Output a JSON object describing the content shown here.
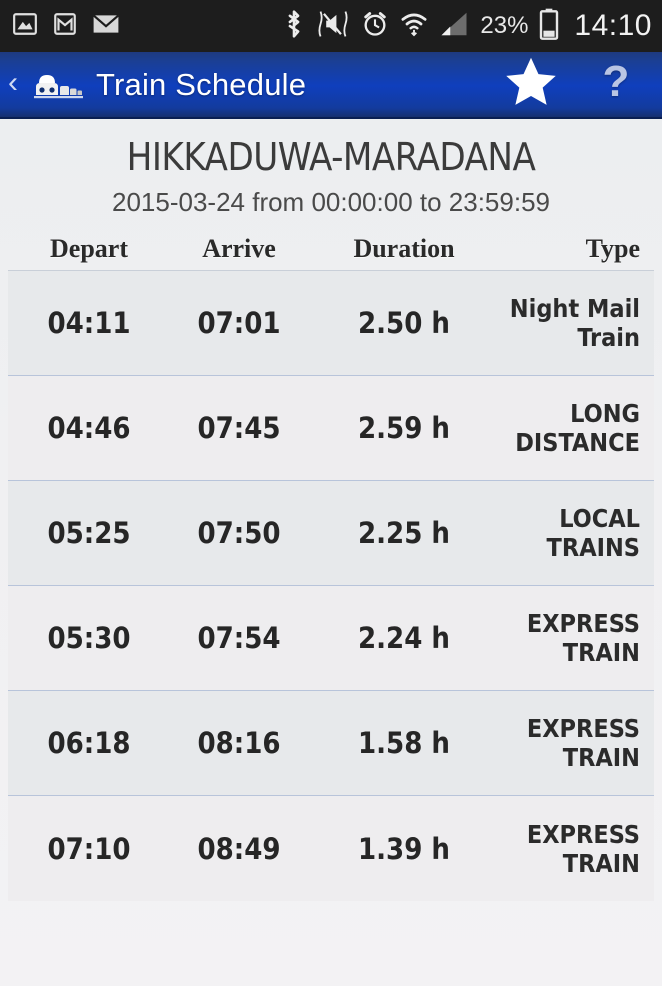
{
  "status_bar": {
    "icons_left": [
      "gallery-icon",
      "gmail-icon",
      "email-icon"
    ],
    "icons_right": [
      "bluetooth-icon",
      "vibrate-mute-icon",
      "alarm-icon",
      "wifi-icon",
      "signal-icon"
    ],
    "battery_percent": "23%",
    "battery_icon": "battery-icon",
    "clock": "14:10",
    "background": "#1d1d1d"
  },
  "action_bar": {
    "back_glyph": "‹",
    "app_icon": "train-icon",
    "title": "Train Schedule",
    "star_label": "★",
    "help_label": "?",
    "accent": "#0f3fbd"
  },
  "header": {
    "route": "HIKKADUWA-MARADANA",
    "range": "2015-03-24 from 00:00:00 to 23:59:59"
  },
  "table": {
    "columns": [
      {
        "key": "depart",
        "label": "Depart"
      },
      {
        "key": "arrive",
        "label": "Arrive"
      },
      {
        "key": "duration",
        "label": "Duration"
      },
      {
        "key": "type",
        "label": "Type"
      }
    ],
    "rows": [
      {
        "depart": "04:11",
        "arrive": "07:01",
        "duration": "2.50 h",
        "type": "Night Mail Train"
      },
      {
        "depart": "04:46",
        "arrive": "07:45",
        "duration": "2.59 h",
        "type": "LONG DISTANCE"
      },
      {
        "depart": "05:25",
        "arrive": "07:50",
        "duration": "2.25 h",
        "type": "LOCAL TRAINS"
      },
      {
        "depart": "05:30",
        "arrive": "07:54",
        "duration": "2.24 h",
        "type": "EXPRESS TRAIN"
      },
      {
        "depart": "06:18",
        "arrive": "08:16",
        "duration": "1.58 h",
        "type": "EXPRESS TRAIN"
      },
      {
        "depart": "07:10",
        "arrive": "08:49",
        "duration": "1.39 h",
        "type": "EXPRESS TRAIN"
      }
    ]
  }
}
